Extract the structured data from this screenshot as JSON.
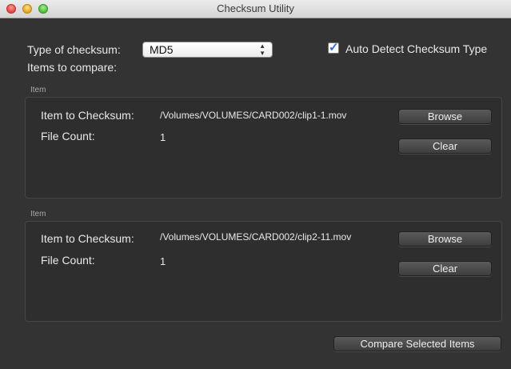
{
  "window": {
    "title": "Checksum Utility"
  },
  "controls": {
    "type_label": "Type of checksum:",
    "type_value": "MD5",
    "auto_detect_label": "Auto Detect Checksum Type",
    "items_label": "Items to compare:"
  },
  "items": [
    {
      "group_label": "Item",
      "checksum_label": "Item to Checksum:",
      "path": "/Volumes/VOLUMES/CARD002/clip1-1.mov",
      "count_label": "File Count:",
      "count": "1",
      "browse": "Browse",
      "clear": "Clear"
    },
    {
      "group_label": "Item",
      "checksum_label": "Item to Checksum:",
      "path": "/Volumes/VOLUMES/CARD002/clip2-11.mov",
      "count_label": "File Count:",
      "count": "1",
      "browse": "Browse",
      "clear": "Clear"
    }
  ],
  "compare_button": "Compare Selected Items",
  "auto_detect_checked": true,
  "colors": {
    "window_bg": "#333333",
    "checkmark": "#2d6fd6"
  }
}
